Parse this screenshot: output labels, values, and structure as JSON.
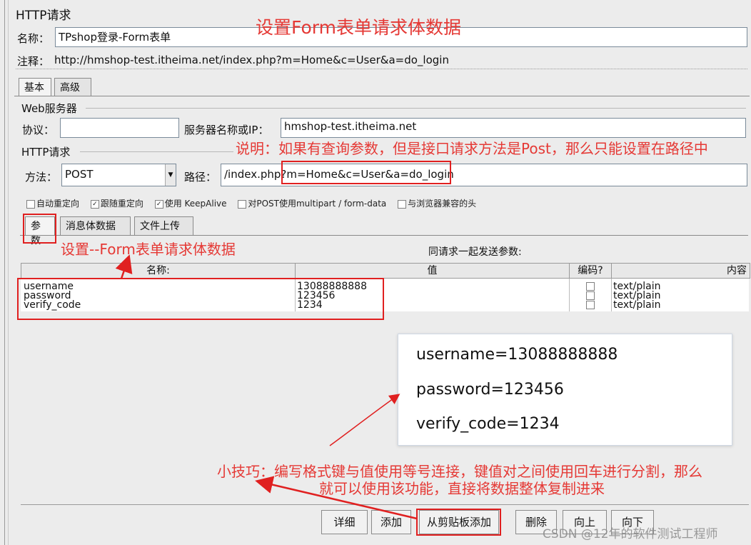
{
  "panel_title": "HTTP请求",
  "name": {
    "label": "名称：",
    "value": "TPshop登录-Form表单"
  },
  "comment": {
    "label": "注释：",
    "value": "http://hmshop-test.itheima.net/index.php?m=Home&c=User&a=do_login"
  },
  "tabs": [
    "基本",
    "高级"
  ],
  "web_server": {
    "group_title": "Web服务器",
    "protocol_label": "协议：",
    "protocol_value": "",
    "server_label": "服务器名称或IP：",
    "server_value": "hmshop-test.itheima.net"
  },
  "http_request": {
    "group_title": "HTTP请求",
    "method_label": "方法：",
    "method_value": "POST",
    "path_label": "路径：",
    "path_value": "/index.php?m=Home&c=User&a=do_login"
  },
  "options": [
    "自动重定向",
    "跟随重定向",
    "使用 KeepAlive",
    "对POST使用multipart / form-data",
    "与浏览器兼容的头"
  ],
  "options_checked": [
    false,
    true,
    true,
    false,
    false
  ],
  "sub_tabs": [
    "参数",
    "消息体数据",
    "文件上传"
  ],
  "params_caption": "同请求一起发送参数:",
  "table": {
    "headers": [
      "名称:",
      "值",
      "编码?",
      "内容"
    ],
    "rows": [
      {
        "name": "username",
        "value": "13088888888",
        "type": "text/plain"
      },
      {
        "name": "password",
        "value": "123456",
        "type": "text/plain"
      },
      {
        "name": "verify_code",
        "value": "1234",
        "type": "text/plain"
      }
    ]
  },
  "tip_card": [
    "username=13088888888",
    "password=123456",
    "verify_code=1234"
  ],
  "buttons": [
    "详细",
    "添加",
    "从剪贴板添加",
    "删除",
    "向上",
    "向下"
  ],
  "annotations": {
    "top": "设置Form表单请求体数据",
    "note": "说明：如果有查询参数，但是接口请求方法是Post，那么只能设置在路径中",
    "params": "设置--Form表单请求体数据",
    "tip_line1": "小技巧：编写格式键与值使用等号连接，键值对之间使用回车进行分割，那么",
    "tip_line2": "就可以使用该功能，直接将数据整体复制进来"
  },
  "watermark": "CSDN @12年的软件测试工程师",
  "colors": {
    "annotation_red": "#e53935",
    "background": "#ececec"
  }
}
